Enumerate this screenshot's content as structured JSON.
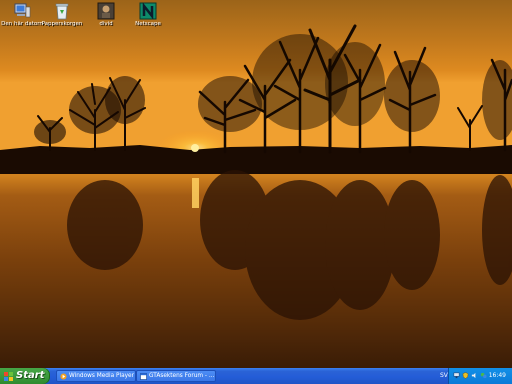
{
  "desktop": {
    "icons": [
      {
        "label": "Den här datorn",
        "icon": "my-computer-icon"
      },
      {
        "label": "Papperskorgen",
        "icon": "recycle-bin-icon"
      },
      {
        "label": "divid",
        "icon": "video-file-icon"
      },
      {
        "label": "Netscape",
        "icon": "netscape-icon"
      }
    ]
  },
  "taskbar": {
    "start_label": "Start",
    "tasks": [
      {
        "label": "Windows Media Player",
        "icon": "media-player-icon"
      },
      {
        "label": "GTAsektens Forum - ...",
        "icon": "browser-window-icon"
      }
    ],
    "language": "SV",
    "clock": "16:49"
  },
  "colors": {
    "taskbar_blue": "#245dd7",
    "start_green": "#3c9a3c",
    "tray_blue": "#0b7ad8",
    "sky_top": "#a86d1c",
    "sun": "#ffd84a"
  }
}
